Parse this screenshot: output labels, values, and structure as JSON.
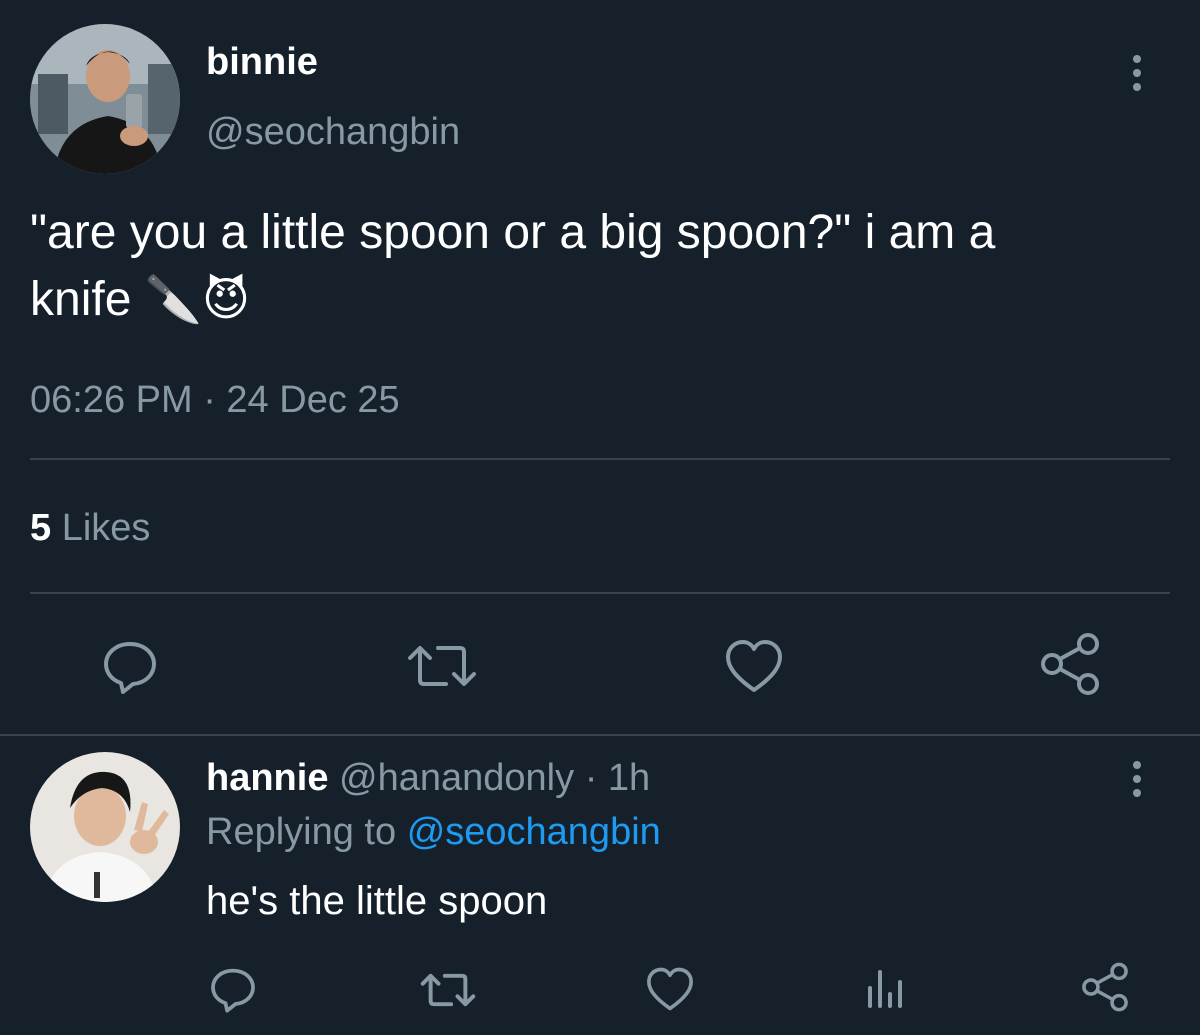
{
  "main_tweet": {
    "display_name": "binnie",
    "handle": "@seochangbin",
    "text_line1": "\"are you a little spoon or a big spoon?\" i am a",
    "text_line2": "knife",
    "emoji_knife": "🔪",
    "emoji_devil": "😈",
    "timestamp": "06:26 PM · 24 Dec 25",
    "likes_count": "5",
    "likes_label": "Likes",
    "actions": [
      "reply-icon",
      "retweet-icon",
      "like-icon",
      "share-icon"
    ]
  },
  "reply": {
    "display_name": "hannie",
    "handle": "@hanandonly",
    "separator": "·",
    "time": "1h",
    "replying_label": "Replying to",
    "replying_handle": "@seochangbin",
    "text": "he's the little spoon",
    "actions": [
      "reply-icon",
      "retweet-icon",
      "like-icon",
      "analytics-icon",
      "share-icon"
    ]
  },
  "colors": {
    "background": "#15202b",
    "text": "#ffffff",
    "muted": "#8899a6",
    "link": "#1d9bf0",
    "divider": "#38444d"
  }
}
